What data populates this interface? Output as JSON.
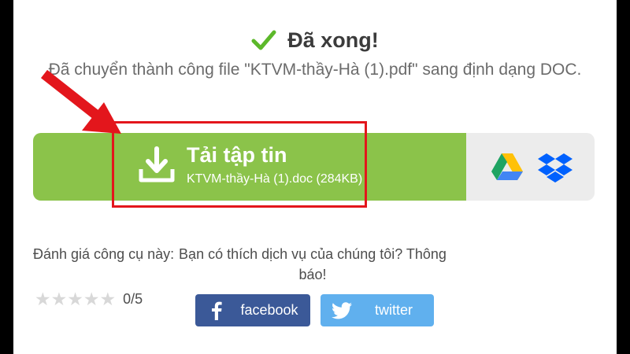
{
  "status": {
    "title": "Đã xong!",
    "message": "Đã chuyển thành công file \"KTVM-thầy-Hà (1).pdf\" sang định dạng DOC.",
    "check_color": "#5cb82a"
  },
  "download": {
    "title": "Tải tập tin",
    "file": "KTVM-thầy-Hà (1).doc (284KB)",
    "button_color": "#8bc34a",
    "icon": "download-icon"
  },
  "cloud": {
    "icons": [
      "google-drive-icon",
      "dropbox-icon"
    ]
  },
  "rating": {
    "label": "Đánh giá công cụ này:",
    "score": "0/5",
    "stars": 5
  },
  "share": {
    "prompt": "Bạn có thích dịch vụ của chúng tôi? Thông báo!",
    "facebook_label": "facebook",
    "twitter_label": "twitter",
    "facebook_color": "#3b5998",
    "twitter_color": "#60b0ee"
  },
  "annotation": {
    "color": "#e3161c"
  }
}
